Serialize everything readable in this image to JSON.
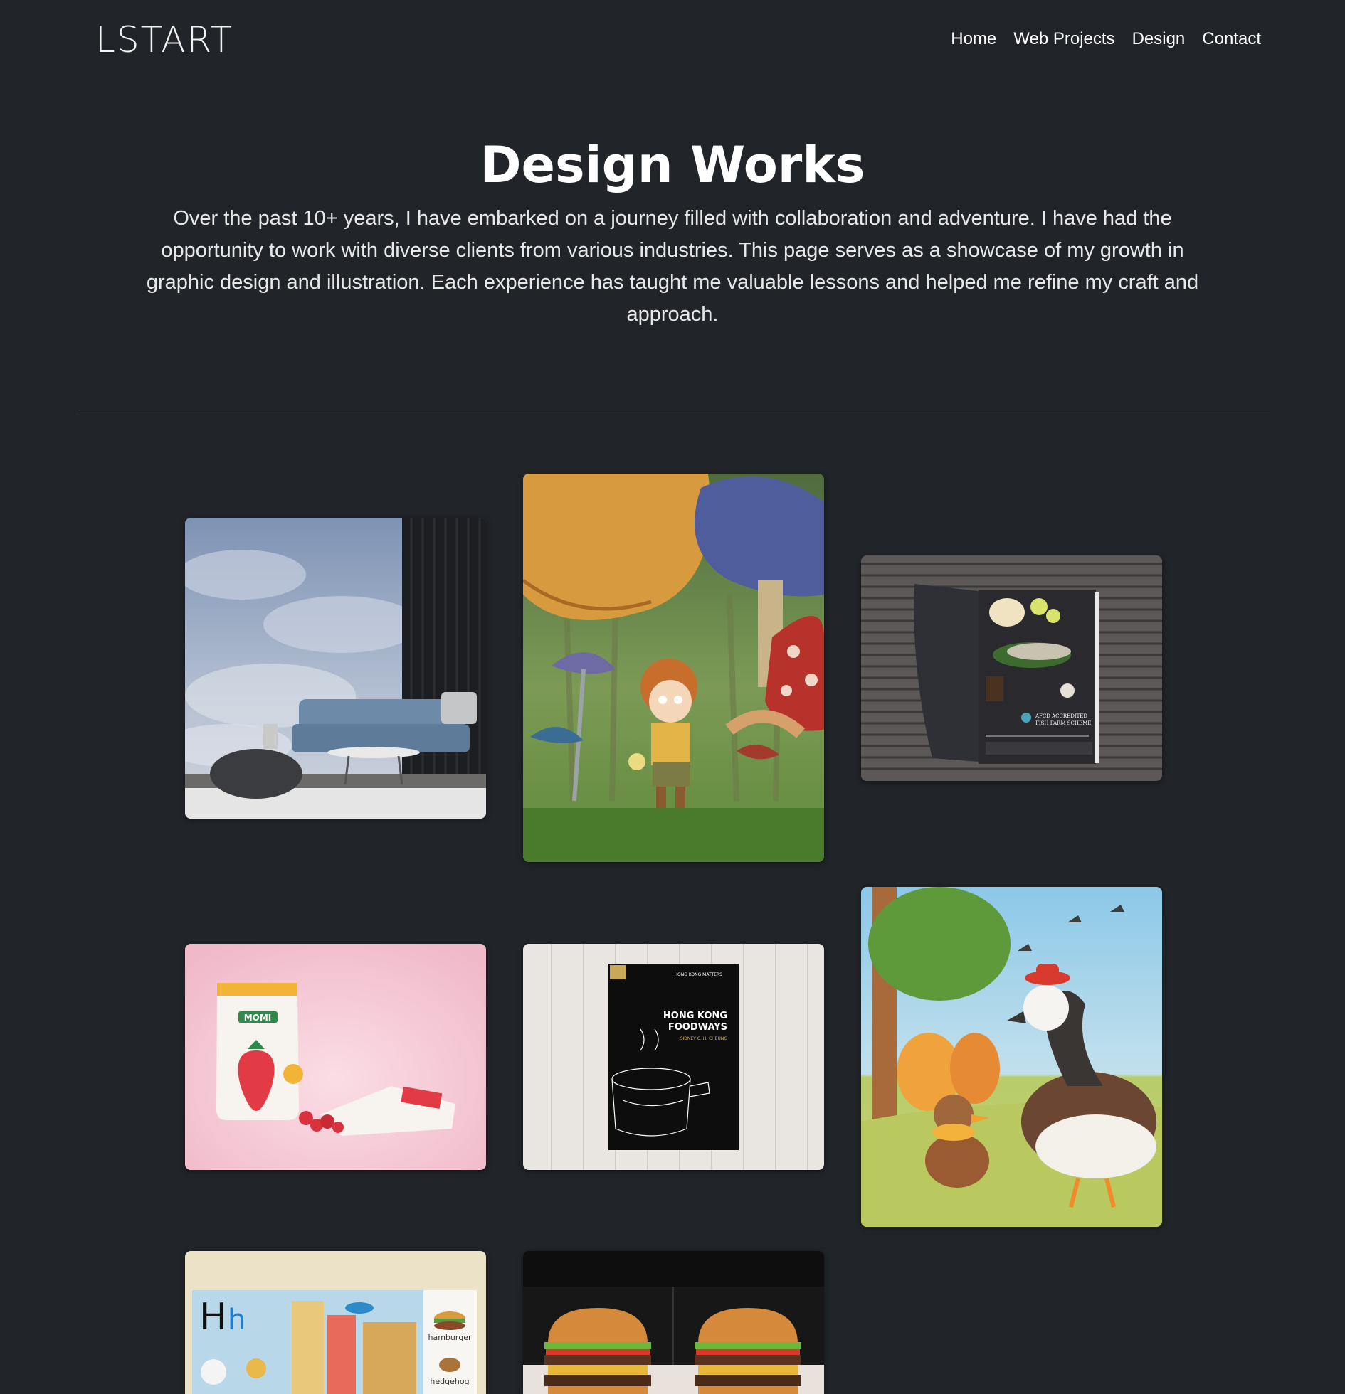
{
  "brand": {
    "name": "LSTART"
  },
  "nav": {
    "items": [
      {
        "label": "Home"
      },
      {
        "label": "Web Projects"
      },
      {
        "label": "Design"
      },
      {
        "label": "Contact"
      }
    ]
  },
  "hero": {
    "title": "Design Works",
    "description": "Over the past 10+ years, I have embarked on a journey filled with collaboration and adventure. I have had the opportunity to work with diverse clients from various industries. This page serves as a showcase of my growth in graphic design and illustration. Each experience has taught me valuable lessons and helped me refine my craft and approach."
  },
  "gallery": {
    "items": [
      {
        "subject": "cloud-mural-living-room"
      },
      {
        "subject": "mushroom-forest-illustration"
      },
      {
        "subject": "fish-farm-brochure"
      },
      {
        "subject": "momi-strawberry-packaging"
      },
      {
        "subject": "hong-kong-foodways-book"
      },
      {
        "subject": "goose-and-duck-illustration"
      },
      {
        "subject": "alphabet-h-illustration"
      },
      {
        "subject": "burger-photography"
      }
    ],
    "brochure_text": {
      "line1": "AFCD ACCREDITED",
      "line2": "FISH FARM SCHEME"
    },
    "momi_label": "MOMI",
    "book": {
      "series": "HONG KONG MATTERS",
      "title_line1": "HONG KONG",
      "title_line2": "FOODWAYS",
      "author": "SIDNEY C. H. CHEUNG"
    },
    "alphabet": {
      "letter_upper": "H",
      "letter_lower": "h",
      "word1": "hamburger",
      "word2": "hedgehog"
    }
  },
  "colors": {
    "background": "#212429",
    "divider": "#4a4d52",
    "text": "#ffffff"
  }
}
